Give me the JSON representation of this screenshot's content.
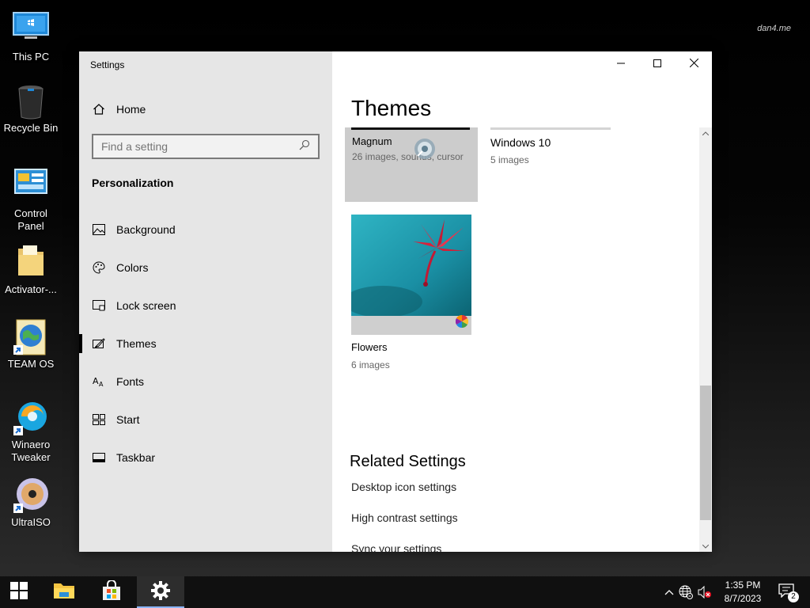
{
  "desktop": {
    "icons": [
      {
        "label": "This PC",
        "icon": "computer-icon"
      },
      {
        "label": "Recycle Bin",
        "icon": "recycle-bin-icon"
      },
      {
        "label": "Control Panel",
        "icon": "control-panel-icon"
      },
      {
        "label": "Activator-...",
        "icon": "folder-icon"
      },
      {
        "label": "TEAM OS",
        "icon": "globe-icon"
      },
      {
        "label": "Winaero Tweaker",
        "icon": "winaero-icon"
      },
      {
        "label": "UltraISO",
        "icon": "disc-icon"
      }
    ],
    "watermark": "dan4.me"
  },
  "window": {
    "title": "Settings",
    "controls": [
      "minimize-icon",
      "maximize-icon",
      "close-icon"
    ]
  },
  "sidebar": {
    "home_label": "Home",
    "search_placeholder": "Find a setting",
    "section": "Personalization",
    "items": [
      {
        "label": "Background",
        "icon": "image-icon",
        "active": false
      },
      {
        "label": "Colors",
        "icon": "palette-icon",
        "active": false
      },
      {
        "label": "Lock screen",
        "icon": "lock-screen-icon",
        "active": false
      },
      {
        "label": "Themes",
        "icon": "brush-icon",
        "active": true
      },
      {
        "label": "Fonts",
        "icon": "fonts-icon",
        "active": false
      },
      {
        "label": "Start",
        "icon": "start-icon",
        "active": false
      },
      {
        "label": "Taskbar",
        "icon": "taskbar-icon",
        "active": false
      }
    ]
  },
  "main": {
    "title": "Themes",
    "themes": [
      {
        "name": "Magnum",
        "subtitle": "26 images, sounds, cursor",
        "selected": true
      },
      {
        "name": "Windows 10",
        "subtitle": "5 images",
        "selected": false
      },
      {
        "name": "Flowers",
        "subtitle": "6 images",
        "selected": false
      }
    ],
    "related_title": "Related Settings",
    "related_links": [
      "Desktop icon settings",
      "High contrast settings",
      "Sync your settings"
    ]
  },
  "taskbar": {
    "apps": [
      "start-icon",
      "file-explorer-icon",
      "store-icon",
      "settings-icon"
    ],
    "time": "1:35 PM",
    "date": "8/7/2023",
    "notification_count": "2",
    "colors": {
      "accent": "#8ab4f8",
      "background": "#101010"
    }
  }
}
